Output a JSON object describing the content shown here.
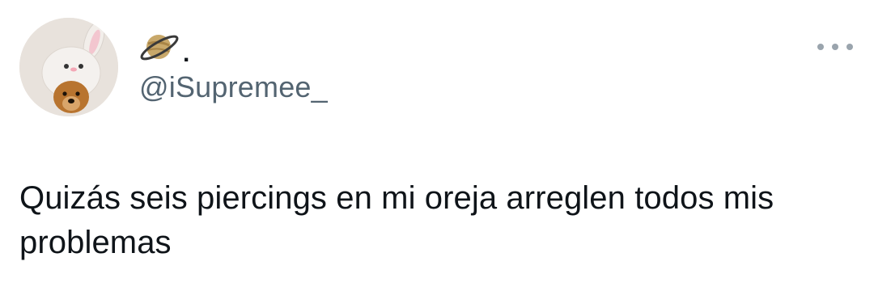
{
  "tweet": {
    "author": {
      "display_name_icon": "ringed-planet-emoji",
      "display_name_suffix": ".",
      "handle": "@iSupremee_",
      "avatar": "dog-in-bunny-hat-photo"
    },
    "text": "Quizás seis piercings en mi oreja arreglen todos mis problemas",
    "more_icon": "more-dots-icon"
  }
}
